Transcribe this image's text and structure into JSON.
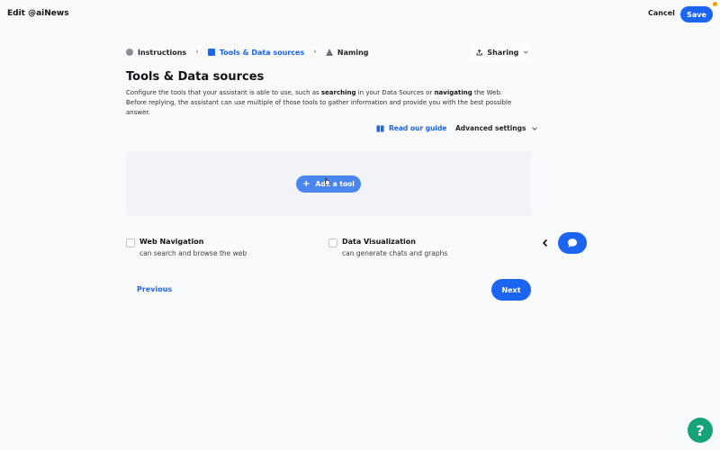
{
  "header": {
    "title": "Edit @aiNews",
    "cancel_label": "Cancel",
    "save_label": "Save"
  },
  "steps": [
    {
      "label": "Instructions",
      "icon": "circle-icon",
      "active": false
    },
    {
      "label": "Tools & Data sources",
      "icon": "square-icon",
      "active": true
    },
    {
      "label": "Naming",
      "icon": "triangle-icon",
      "active": false
    }
  ],
  "sharing_label": "Sharing",
  "page": {
    "title": "Tools & Data sources",
    "desc_1a": "Configure the tools that your assistant is able to use, such as ",
    "desc_1b": "searching",
    "desc_1c": " in your Data Sources or ",
    "desc_1d": "navigating",
    "desc_1e": " the Web.",
    "desc_2": "Before replying, the assistant can use multiple of those tools to gather information and provide you with the best possible answer."
  },
  "guide_label": "Read our guide",
  "advanced_label": "Advanced settings",
  "add_tool_label": "Add a tool",
  "tools": [
    {
      "name": "Web Navigation",
      "desc": "can search and browse the web"
    },
    {
      "name": "Data Visualization",
      "desc": "can generate chats and graphs"
    }
  ],
  "nav": {
    "previous_label": "Previous",
    "next_label": "Next"
  },
  "help_label": "?",
  "colors": {
    "accent": "#1c64f2",
    "help": "#16a37a",
    "notification": "#f59e0b"
  }
}
